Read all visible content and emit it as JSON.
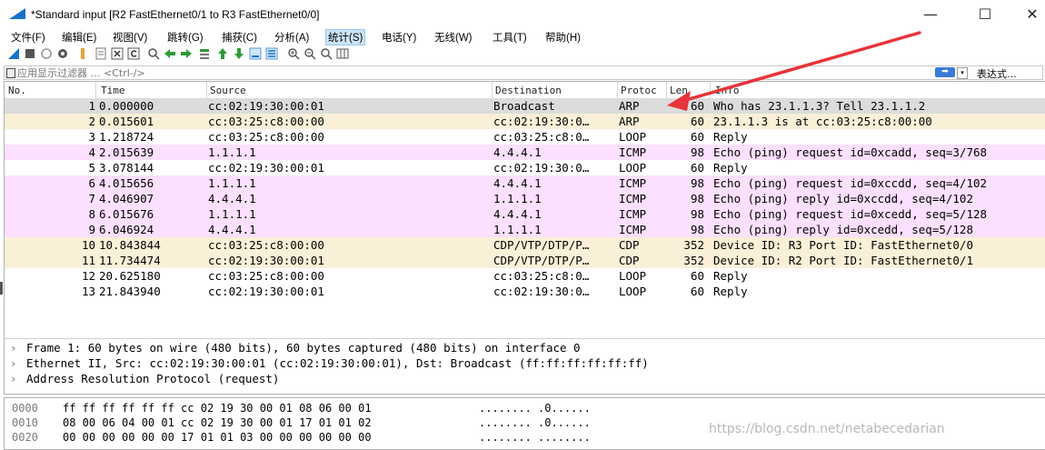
{
  "window": {
    "title": "*Standard input [R2 FastEthernet0/1 to R3 FastEthernet0/0]",
    "minimize": "—",
    "maximize": "☐",
    "close": "✕"
  },
  "menu": [
    "文件(F)",
    "编辑(E)",
    "视图(V)",
    "跳转(G)",
    "捕获(C)",
    "分析(A)",
    "统计(S)",
    "电话(Y)",
    "无线(W)",
    "工具(T)",
    "帮助(H)"
  ],
  "toolbar_icons": [
    "shark-fin-start-icon",
    "stop-icon",
    "restart-icon",
    "options-icon",
    "open-file-icon",
    "save-file-icon",
    "close-file-icon",
    "reload-icon",
    "find-icon",
    "back-icon",
    "forward-icon",
    "goto-icon",
    "first-icon",
    "last-icon",
    "autoscroll-icon",
    "colorize-icon",
    "zoom-in-icon",
    "zoom-out-icon",
    "zoom-normal-icon",
    "resize-columns-icon"
  ],
  "filter": {
    "placeholder": "应用显示过滤器 … <Ctrl-/>",
    "apply": "➡",
    "dropdown": "▾",
    "expression": "表达式…"
  },
  "columns": {
    "no": "No.",
    "time": "Time",
    "source": "Source",
    "destination": "Destination",
    "protocol": "Protoc",
    "length": "Len",
    "info": "Info"
  },
  "packets": [
    {
      "no": "1",
      "time": "0.000000",
      "src": "cc:02:19:30:00:01",
      "dst": "Broadcast",
      "proto": "ARP",
      "len": "60",
      "info": "Who has 23.1.1.3? Tell 23.1.1.2",
      "bg": "#dcdcdc"
    },
    {
      "no": "2",
      "time": "0.015601",
      "src": "cc:03:25:c8:00:00",
      "dst": "cc:02:19:30:0…",
      "proto": "ARP",
      "len": "60",
      "info": "23.1.1.3 is at cc:03:25:c8:00:00",
      "bg": "#faf0d7"
    },
    {
      "no": "3",
      "time": "1.218724",
      "src": "cc:03:25:c8:00:00",
      "dst": "cc:03:25:c8:0…",
      "proto": "LOOP",
      "len": "60",
      "info": "Reply",
      "bg": "#ffffff"
    },
    {
      "no": "4",
      "time": "2.015639",
      "src": "1.1.1.1",
      "dst": "4.4.4.1",
      "proto": "ICMP",
      "len": "98",
      "info": "Echo (ping) request  id=0xcadd, seq=3/768",
      "bg": "#fce0ff"
    },
    {
      "no": "5",
      "time": "3.078144",
      "src": "cc:02:19:30:00:01",
      "dst": "cc:02:19:30:0…",
      "proto": "LOOP",
      "len": "60",
      "info": "Reply",
      "bg": "#ffffff"
    },
    {
      "no": "6",
      "time": "4.015656",
      "src": "1.1.1.1",
      "dst": "4.4.4.1",
      "proto": "ICMP",
      "len": "98",
      "info": "Echo (ping) request  id=0xccdd, seq=4/102",
      "bg": "#fce0ff"
    },
    {
      "no": "7",
      "time": "4.046907",
      "src": "4.4.4.1",
      "dst": "1.1.1.1",
      "proto": "ICMP",
      "len": "98",
      "info": "Echo (ping) reply    id=0xccdd, seq=4/102",
      "bg": "#fce0ff"
    },
    {
      "no": "8",
      "time": "6.015676",
      "src": "1.1.1.1",
      "dst": "4.4.4.1",
      "proto": "ICMP",
      "len": "98",
      "info": "Echo (ping) request  id=0xcedd, seq=5/128",
      "bg": "#fce0ff"
    },
    {
      "no": "9",
      "time": "6.046924",
      "src": "4.4.4.1",
      "dst": "1.1.1.1",
      "proto": "ICMP",
      "len": "98",
      "info": "Echo (ping) reply    id=0xcedd, seq=5/128",
      "bg": "#fce0ff"
    },
    {
      "no": "10",
      "time": "10.843844",
      "src": "cc:03:25:c8:00:00",
      "dst": "CDP/VTP/DTP/P…",
      "proto": "CDP",
      "len": "352",
      "info": "Device ID: R3  Port ID: FastEthernet0/0",
      "bg": "#faf0d7"
    },
    {
      "no": "11",
      "time": "11.734474",
      "src": "cc:02:19:30:00:01",
      "dst": "CDP/VTP/DTP/P…",
      "proto": "CDP",
      "len": "352",
      "info": "Device ID: R2  Port ID: FastEthernet0/1",
      "bg": "#faf0d7"
    },
    {
      "no": "12",
      "time": "20.625180",
      "src": "cc:03:25:c8:00:00",
      "dst": "cc:03:25:c8:0…",
      "proto": "LOOP",
      "len": "60",
      "info": "Reply",
      "bg": "#ffffff"
    },
    {
      "no": "13",
      "time": "21.843940",
      "src": "cc:02:19:30:00:01",
      "dst": "cc:02:19:30:0…",
      "proto": "LOOP",
      "len": "60",
      "info": "Reply",
      "bg": "#ffffff"
    }
  ],
  "details": [
    "Frame 1: 60 bytes on wire (480 bits), 60 bytes captured (480 bits) on interface 0",
    "Ethernet II, Src: cc:02:19:30:00:01 (cc:02:19:30:00:01), Dst: Broadcast (ff:ff:ff:ff:ff:ff)",
    "Address Resolution Protocol (request)"
  ],
  "bytes": [
    {
      "offset": "0000",
      "hex": "ff ff ff ff ff ff cc 02  19 30 00 01 08 06 00 01",
      "ascii": "........ .0......"
    },
    {
      "offset": "0010",
      "hex": "08 00 06 04 00 01 cc 02  19 30 00 01 17 01 01 02",
      "ascii": "........ .0......"
    },
    {
      "offset": "0020",
      "hex": "00 00 00 00 00 00 17 01  01 03 00 00 00 00 00 00",
      "ascii": "........ ........"
    }
  ],
  "watermark": "https://blog.csdn.net/netabecedarian",
  "colors": {
    "accent": "#1a73c8",
    "arrow": "#e8343a",
    "selected_row": "#dcdcdc",
    "arp_cdp_row": "#faf0d7",
    "icmp_row": "#fce0ff"
  }
}
